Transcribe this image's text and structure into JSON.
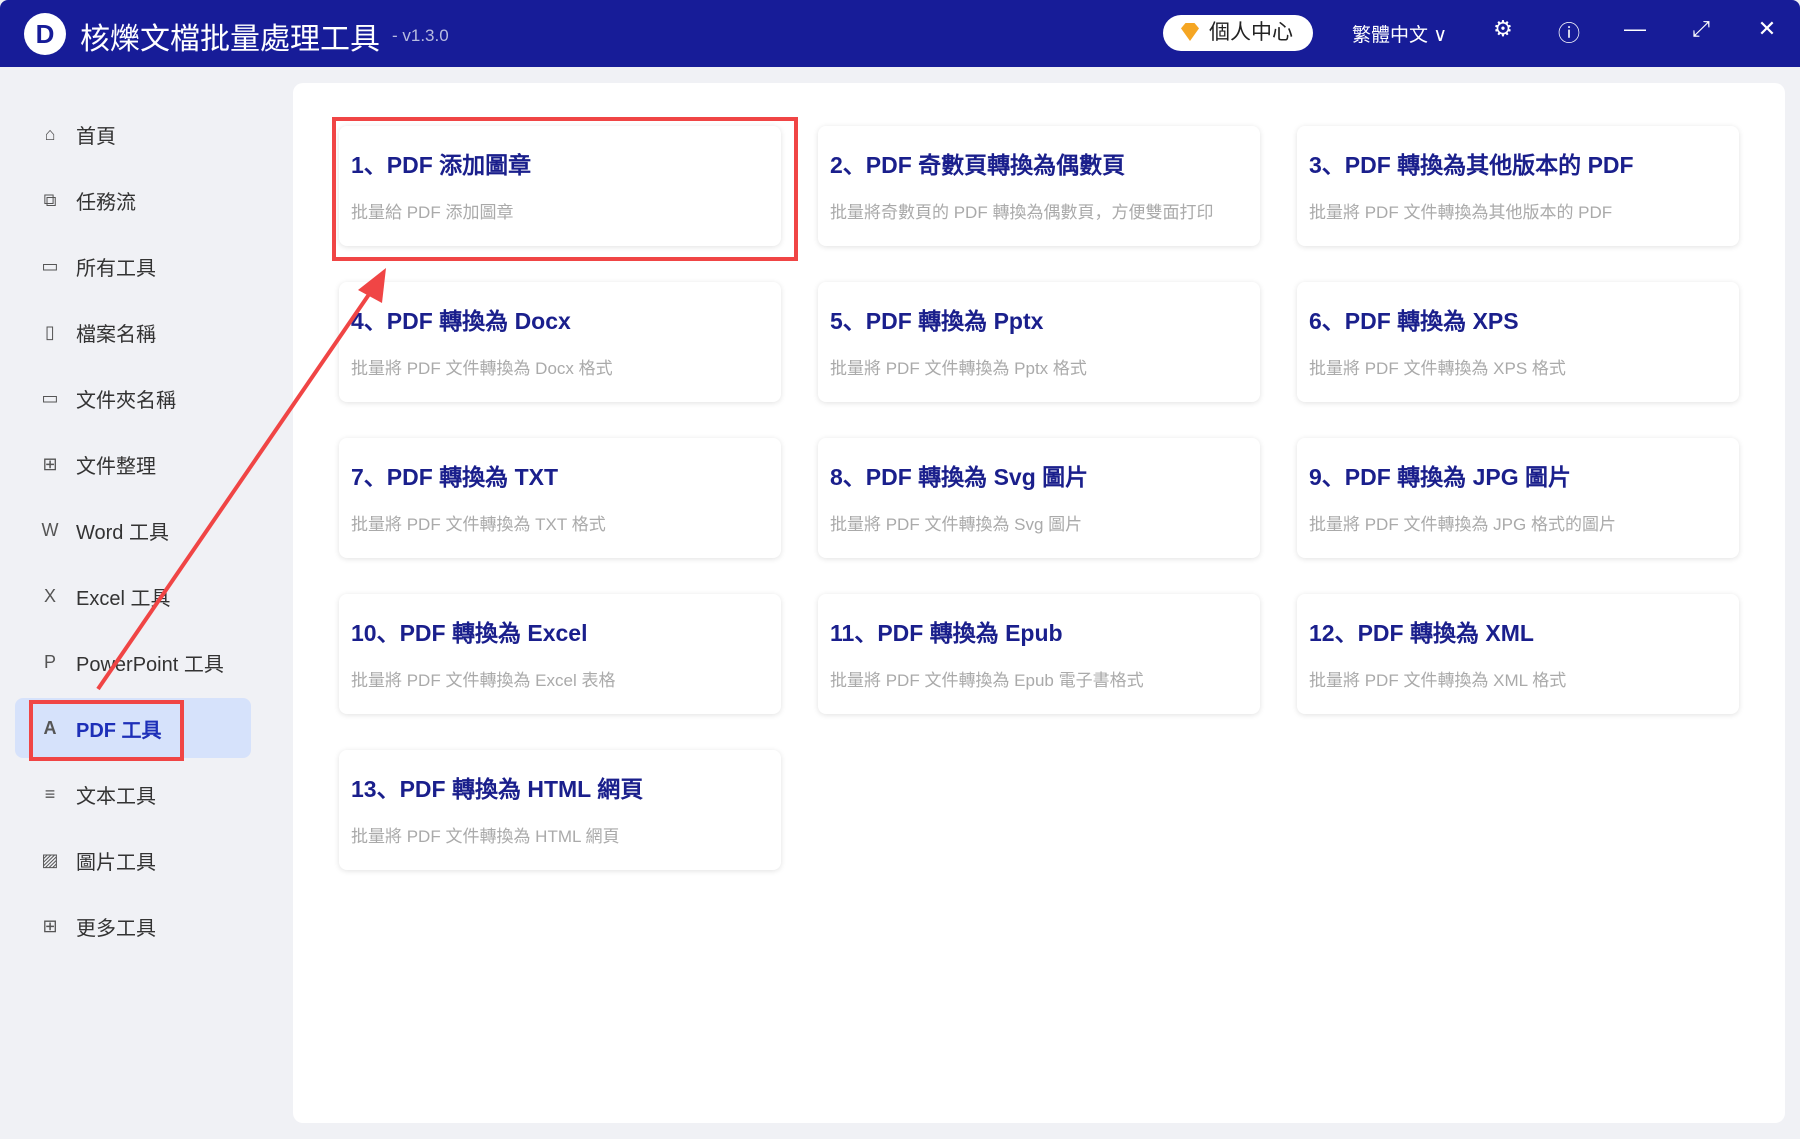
{
  "app": {
    "title": "核爍文檔批量處理工具",
    "version": "- v1.3.0",
    "user_center": "個人中心",
    "language": "繁體中文"
  },
  "sidebar": {
    "items": [
      {
        "label": "首頁",
        "icon": "home-icon"
      },
      {
        "label": "任務流",
        "icon": "workflow-icon"
      },
      {
        "label": "所有工具",
        "icon": "monitor-icon"
      },
      {
        "label": "檔案名稱",
        "icon": "file-icon"
      },
      {
        "label": "文件夾名稱",
        "icon": "folder-icon"
      },
      {
        "label": "文件整理",
        "icon": "organize-icon"
      },
      {
        "label": "Word 工具",
        "icon": "word-icon"
      },
      {
        "label": "Excel 工具",
        "icon": "excel-icon"
      },
      {
        "label": "PowerPoint 工具",
        "icon": "ppt-icon"
      },
      {
        "label": "PDF 工具",
        "icon": "pdf-icon"
      },
      {
        "label": "文本工具",
        "icon": "text-icon"
      },
      {
        "label": "圖片工具",
        "icon": "image-icon"
      },
      {
        "label": "更多工具",
        "icon": "grid-icon"
      }
    ],
    "active": "PDF 工具"
  },
  "tools": [
    {
      "title": "1、PDF 添加圖章",
      "desc": "批量給 PDF 添加圖章"
    },
    {
      "title": "2、PDF 奇數頁轉換為偶數頁",
      "desc": "批量將奇數頁的 PDF 轉換為偶數頁，方便雙面打印"
    },
    {
      "title": "3、PDF 轉換為其他版本的 PDF",
      "desc": "批量將 PDF 文件轉換為其他版本的 PDF"
    },
    {
      "title": "4、PDF 轉換為 Docx",
      "desc": "批量將 PDF 文件轉換為 Docx 格式"
    },
    {
      "title": "5、PDF 轉換為 Pptx",
      "desc": "批量將 PDF 文件轉換為 Pptx 格式"
    },
    {
      "title": "6、PDF 轉換為 XPS",
      "desc": "批量將 PDF 文件轉換為 XPS 格式"
    },
    {
      "title": "7、PDF 轉換為 TXT",
      "desc": "批量將 PDF 文件轉換為 TXT 格式"
    },
    {
      "title": "8、PDF 轉換為 Svg 圖片",
      "desc": "批量將 PDF 文件轉換為 Svg 圖片"
    },
    {
      "title": "9、PDF 轉換為 JPG 圖片",
      "desc": "批量將 PDF 文件轉換為 JPG 格式的圖片"
    },
    {
      "title": "10、PDF 轉換為 Excel",
      "desc": "批量將 PDF 文件轉換為 Excel 表格"
    },
    {
      "title": "11、PDF 轉換為 Epub",
      "desc": "批量將 PDF 文件轉換為 Epub 電子書格式"
    },
    {
      "title": "12、PDF 轉換為 XML",
      "desc": "批量將 PDF 文件轉換為 XML 格式"
    },
    {
      "title": "13、PDF 轉換為 HTML 網頁",
      "desc": "批量將 PDF 文件轉換為 HTML 網頁"
    }
  ],
  "colors": {
    "titlebar": "#171c98",
    "accent": "#1d2fb8",
    "highlight": "#f04545"
  }
}
